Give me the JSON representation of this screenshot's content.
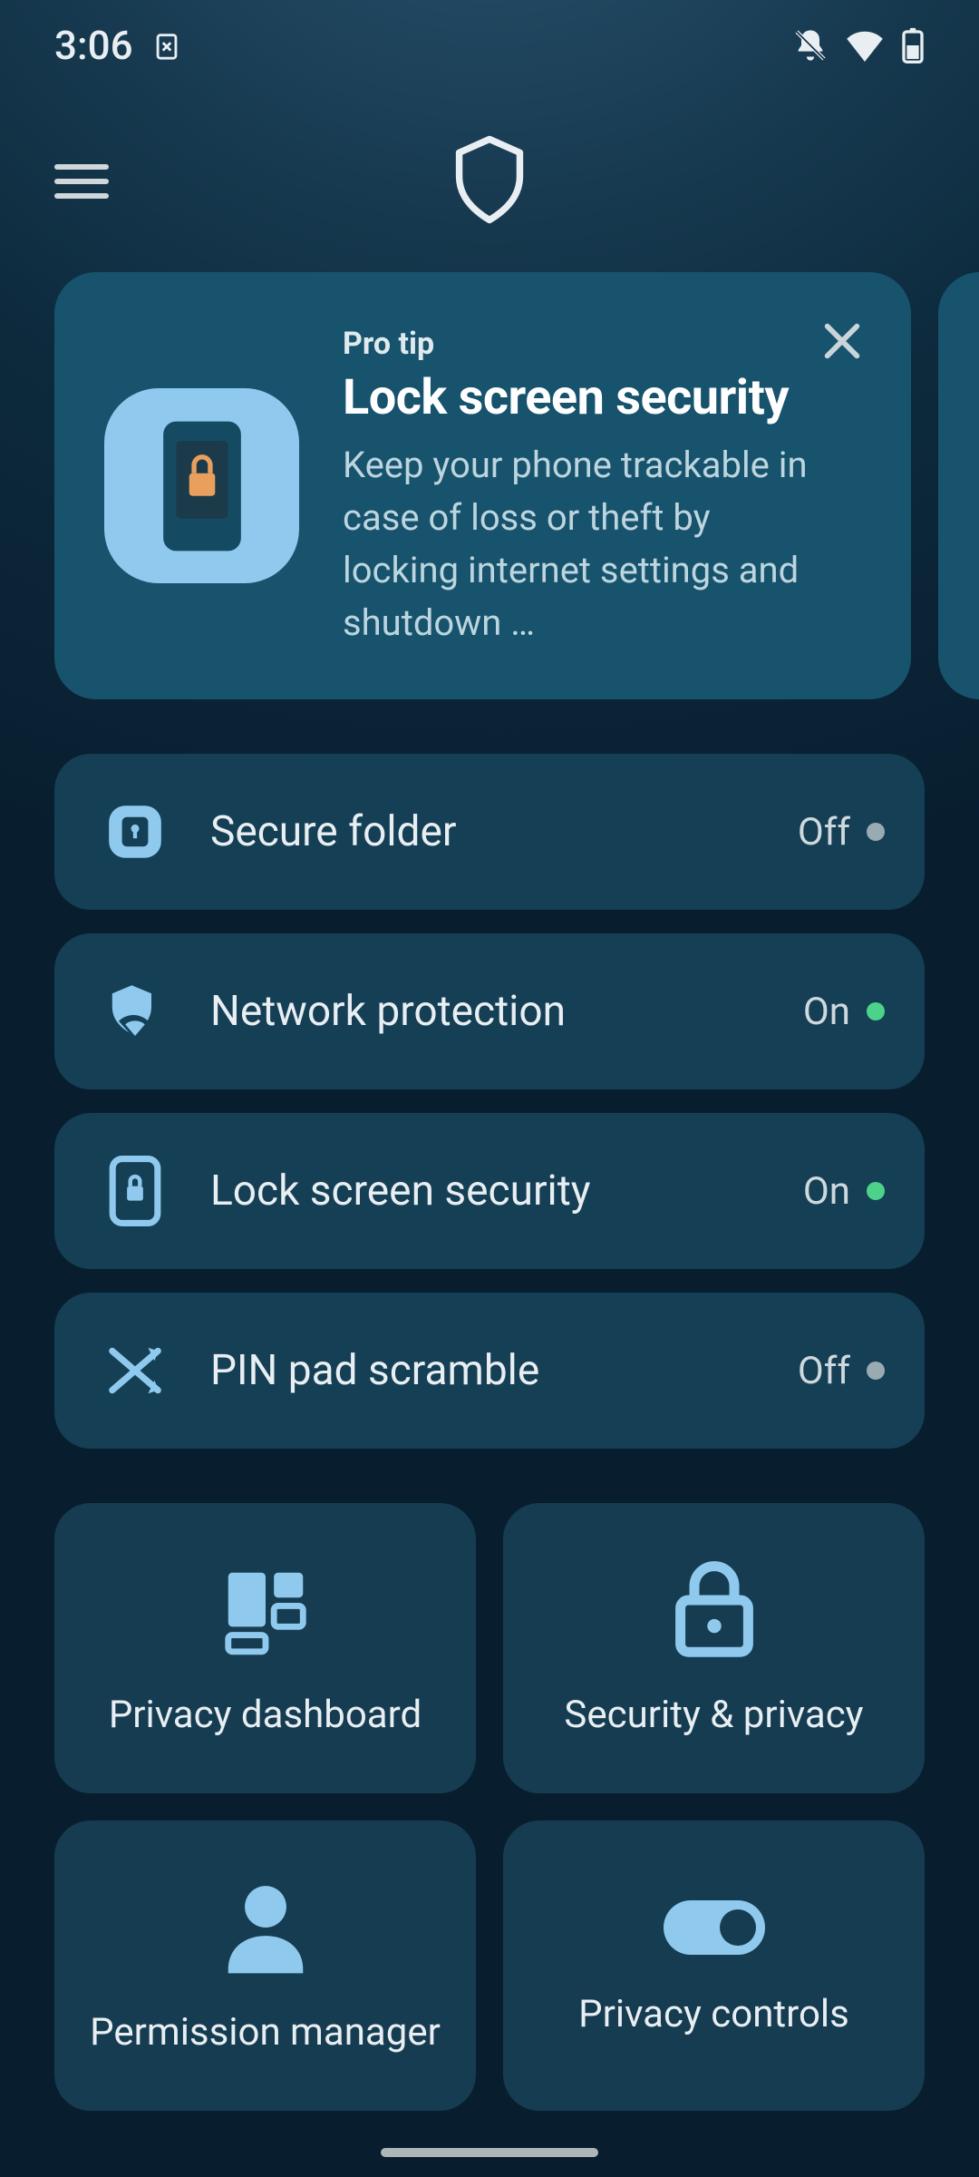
{
  "status": {
    "time": "3:06"
  },
  "tip": {
    "eyebrow": "Pro tip",
    "title": "Lock screen security",
    "body": "Keep your phone trackable in case of loss or theft by locking internet settings and shutdown …"
  },
  "rows": [
    {
      "label": "Secure folder",
      "status": "Off",
      "on": false
    },
    {
      "label": "Network protection",
      "status": "On",
      "on": true
    },
    {
      "label": "Lock screen security",
      "status": "On",
      "on": true
    },
    {
      "label": "PIN pad scramble",
      "status": "Off",
      "on": false
    }
  ],
  "tiles": [
    {
      "label": "Privacy dashboard"
    },
    {
      "label": "Security & privacy"
    },
    {
      "label": "Permission manager"
    },
    {
      "label": "Privacy controls"
    }
  ],
  "colors": {
    "accent": "#8fcaee",
    "status_on": "#4dd28a",
    "status_off": "#9aaab2"
  }
}
